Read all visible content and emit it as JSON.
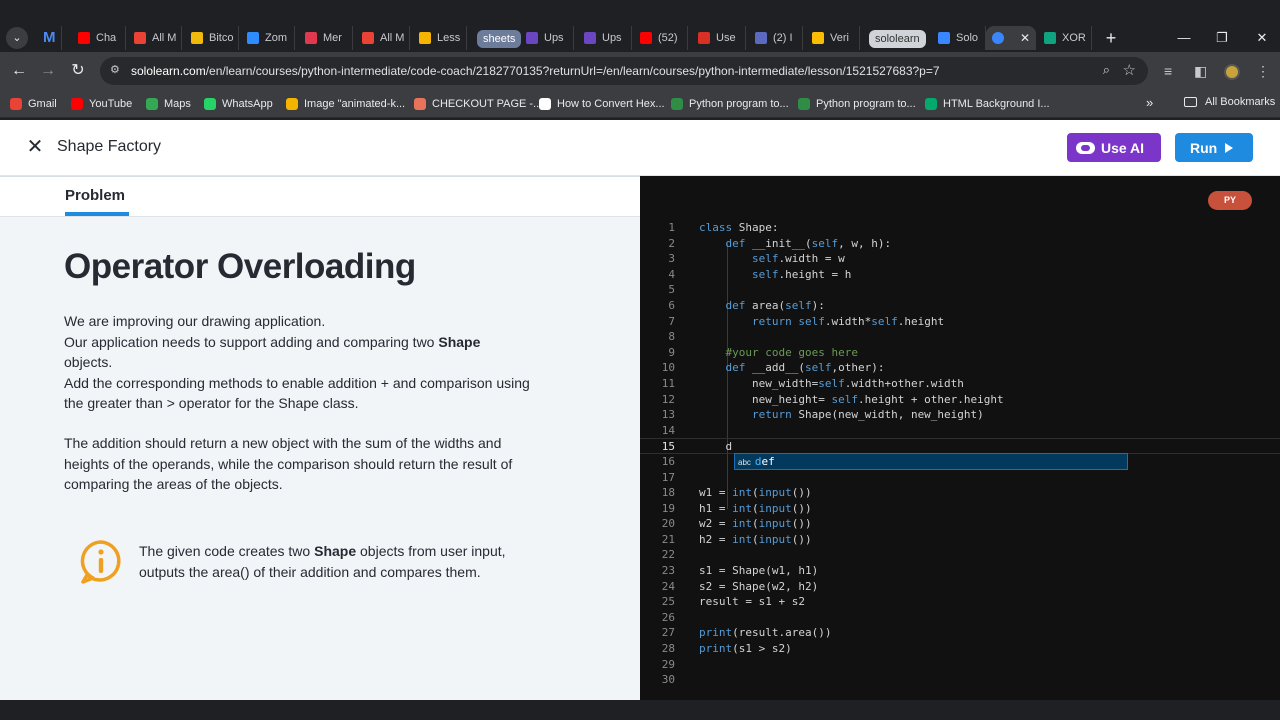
{
  "browser": {
    "tabs": [
      {
        "label": "Cha",
        "icon": "youtube-icon",
        "color": "#ff0000"
      },
      {
        "label": "All M",
        "icon": "gmail-icon",
        "color": "#ea4335"
      },
      {
        "label": "Bitco",
        "icon": "binance-icon",
        "color": "#f0b90b"
      },
      {
        "label": "Zom",
        "icon": "zoom-icon",
        "color": "#2d8cff"
      },
      {
        "label": "Mer",
        "icon": "app-icon",
        "color": "#e0394f"
      },
      {
        "label": "All M",
        "icon": "gmail-icon",
        "color": "#ea4335"
      },
      {
        "label": "Less",
        "icon": "lesson-icon",
        "color": "#f4b400"
      },
      {
        "label": "Ups",
        "icon": "upwork-icon",
        "color": "#6b46c1"
      },
      {
        "label": "Ups",
        "icon": "upwork-icon",
        "color": "#6b46c1"
      },
      {
        "label": "(52)",
        "icon": "youtube-icon",
        "color": "#ff0000"
      },
      {
        "label": "Use",
        "icon": "doc-icon",
        "color": "#d93025"
      },
      {
        "label": "(2) I",
        "icon": "app-icon",
        "color": "#5b6abf"
      },
      {
        "label": "Veri",
        "icon": "drive-icon",
        "color": "#fbbc04"
      },
      {
        "label": "Solo",
        "icon": "sololearn-icon",
        "color": "#3a86ff"
      },
      {
        "label": "XOR",
        "icon": "chatgpt-icon",
        "color": "#10a37f"
      }
    ],
    "group_sheets": "sheets",
    "group_sololearn": "sololearn",
    "url_host": "sololearn.com",
    "url_path": "/en/learn/courses/python-intermediate/code-coach/2182770135?returnUrl=/en/learn/courses/python-intermediate/lesson/1521527683?p=7",
    "bookmarks": [
      {
        "label": "Gmail",
        "color": "#ea4335"
      },
      {
        "label": "YouTube",
        "color": "#ff0000"
      },
      {
        "label": "Maps",
        "color": "#34a853"
      },
      {
        "label": "WhatsApp",
        "color": "#25d366"
      },
      {
        "label": "Image \"animated-k...",
        "color": "#f4b400"
      },
      {
        "label": "CHECKOUT PAGE -...",
        "color": "#e8735a"
      },
      {
        "label": "How to Convert Hex...",
        "color": "#ffffff"
      },
      {
        "label": "Python program to...",
        "color": "#2f8d46"
      },
      {
        "label": "Python program to...",
        "color": "#2f8d46"
      },
      {
        "label": "HTML Background I...",
        "color": "#04aa6d"
      }
    ],
    "all_bookmarks": "All Bookmarks"
  },
  "header": {
    "title": "Shape Factory",
    "use_ai": "Use AI",
    "run": "Run"
  },
  "problem": {
    "tab": "Problem",
    "heading": "Operator Overloading",
    "p1_l1": "We are improving our drawing application.",
    "p1_l2_a": "Our application needs to support adding and comparing two ",
    "p1_l2_b": "Shape",
    "p1_l3": "objects.",
    "p1_l4": "Add the corresponding methods to enable addition + and comparison using",
    "p1_l5": "the greater than > operator for the Shape class.",
    "p2_l1": "The addition should return a new object with the sum of the widths and",
    "p2_l2": "heights of the operands, while the comparison should return the result of",
    "p2_l3": "comparing the areas of the objects.",
    "hint_a": "The given code creates two ",
    "hint_b": "Shape",
    "hint_c": " objects from user input,",
    "hint_l2": "outputs the area() of their addition and compares them."
  },
  "editor": {
    "language": "PY",
    "accent_keyword": "#569cd6",
    "accent_comment": "#6a9955",
    "suggestion_kind": "abc",
    "suggestion_typed": "d",
    "suggestion_rest": "ef",
    "lines": [
      "class Shape:",
      "    def __init__(self, w, h):",
      "        self.width = w",
      "        self.height = h",
      "",
      "    def area(self):",
      "        return self.width*self.height",
      "",
      "    #your code goes here",
      "    def __add__(self,other):",
      "        new_width=self.width+other.width",
      "        new_height= self.height + other.height",
      "        return Shape(new_width, new_height)",
      "",
      "    d",
      "",
      "",
      "w1 = int(input())",
      "h1 = int(input())",
      "w2 = int(input())",
      "h2 = int(input())",
      "",
      "s1 = Shape(w1, h1)",
      "s2 = Shape(w2, h2)",
      "result = s1 + s2",
      "",
      "print(result.area())",
      "print(s1 > s2)",
      "",
      ""
    ]
  }
}
